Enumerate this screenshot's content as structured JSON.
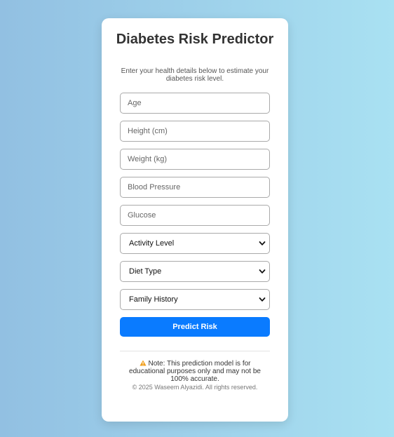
{
  "header": {
    "title": "Diabetes Risk Predictor",
    "subtitle": "Enter your health details below to estimate your diabetes risk level."
  },
  "form": {
    "inputs": [
      {
        "placeholder": "Age",
        "value": ""
      },
      {
        "placeholder": "Height (cm)",
        "value": ""
      },
      {
        "placeholder": "Weight (kg)",
        "value": ""
      },
      {
        "placeholder": "Blood Pressure",
        "value": ""
      },
      {
        "placeholder": "Glucose",
        "value": ""
      }
    ],
    "selects": [
      {
        "selected": "Activity Level"
      },
      {
        "selected": "Diet Type"
      },
      {
        "selected": "Family History"
      }
    ],
    "submit_label": "Predict Risk"
  },
  "footer": {
    "note": "Note: This prediction model is for educational purposes only and may not be 100% accurate.",
    "copyright": "© 2025 Waseem Alyazidi. All rights reserved."
  },
  "icons": {
    "warning": "warning-icon",
    "select_arrow": "chevron-down-icon"
  },
  "colors": {
    "primary_button": "#0a7bff",
    "background_left": "#92c0e2",
    "background_right": "#a9e1f2",
    "warning": "#f0a020"
  }
}
